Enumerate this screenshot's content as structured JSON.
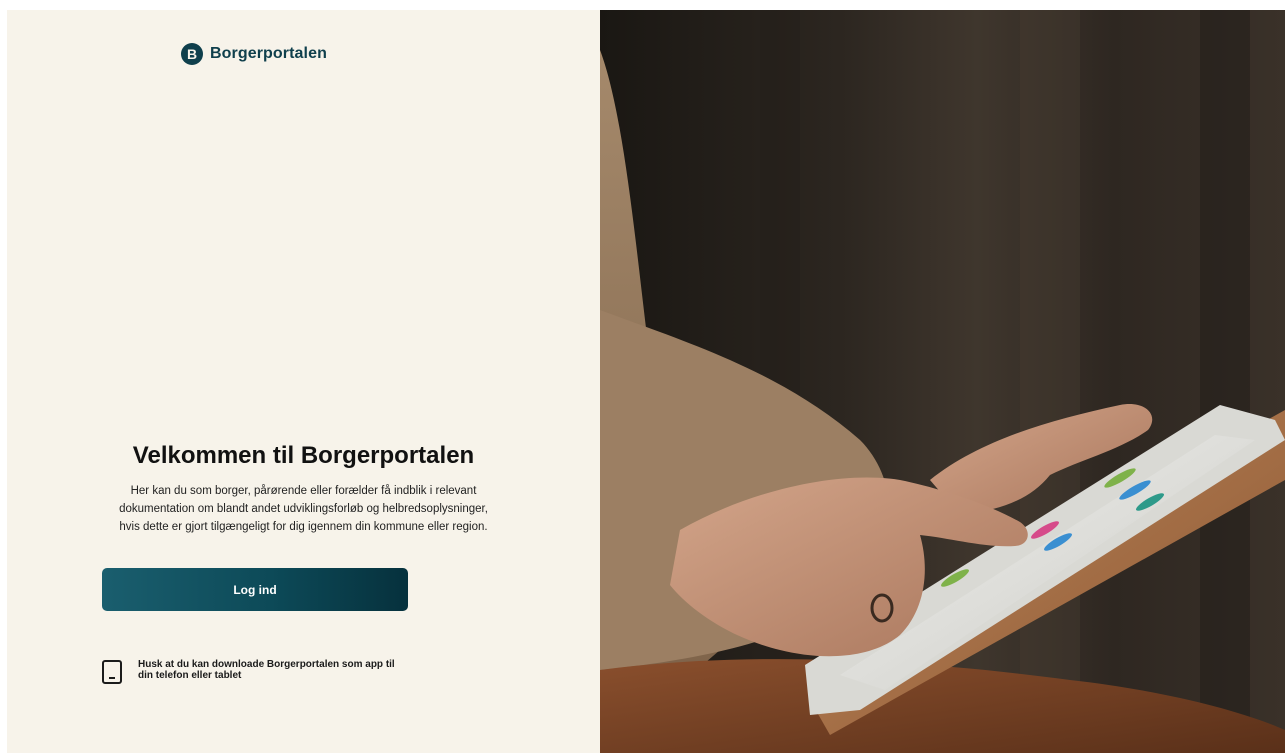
{
  "brand": {
    "logo_letter": "B",
    "name": "Borgerportalen"
  },
  "welcome": {
    "title": "Velkommen til Borgerportalen",
    "description": "Her kan du som borger, pårørende eller forælder få indblik i relevant dokumentation om blandt andet udviklingsforløb og helbredsoplysninger, hvis dette er gjort tilgængeligt for dig igennem din kommune eller region."
  },
  "login": {
    "label": "Log ind"
  },
  "app_hint": {
    "icon": "tablet-icon",
    "text": "Husk at du kan downloade Borgerportalen som app til din telefon eller tablet"
  },
  "colors": {
    "background": "#f7f3ea",
    "brand": "#0f3f4c",
    "button": "#0d4a58"
  }
}
